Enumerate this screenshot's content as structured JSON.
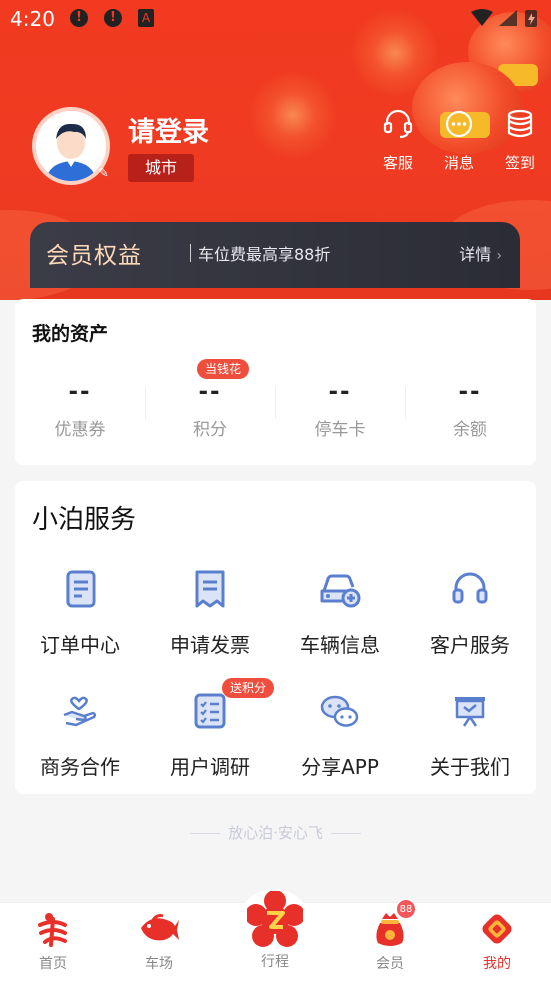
{
  "status_bar": {
    "time": "4:20"
  },
  "profile": {
    "login_title": "请登录",
    "city_label": "城市"
  },
  "top_actions": [
    {
      "label": "客服",
      "icon": "headset-icon"
    },
    {
      "label": "消息",
      "icon": "message-bubble-icon"
    },
    {
      "label": "签到",
      "icon": "coin-stack-icon"
    }
  ],
  "member_banner": {
    "title": "会员权益",
    "desc": "车位费最高享88折",
    "detail": "详情"
  },
  "assets": {
    "title": "我的资产",
    "badge": "当钱花",
    "items": [
      {
        "value": "--",
        "label": "优惠券"
      },
      {
        "value": "--",
        "label": "积分"
      },
      {
        "value": "--",
        "label": "停车卡"
      },
      {
        "value": "--",
        "label": "余额"
      }
    ]
  },
  "services": {
    "title": "小泊服务",
    "badge": "送积分",
    "items": [
      {
        "label": "订单中心",
        "icon": "order-doc-icon"
      },
      {
        "label": "申请发票",
        "icon": "invoice-icon"
      },
      {
        "label": "车辆信息",
        "icon": "car-add-icon"
      },
      {
        "label": "客户服务",
        "icon": "headset-icon"
      },
      {
        "label": "商务合作",
        "icon": "handshake-heart-icon"
      },
      {
        "label": "用户调研",
        "icon": "checklist-icon"
      },
      {
        "label": "分享APP",
        "icon": "wechat-icon"
      },
      {
        "label": "关于我们",
        "icon": "presentation-board-icon"
      }
    ]
  },
  "slogan": "放心泊·安心飞",
  "tabbar": {
    "items": [
      {
        "label": "首页",
        "icon": "home-logo-icon"
      },
      {
        "label": "车场",
        "icon": "fish-icon"
      },
      {
        "label": "行程",
        "icon": "trip-plum-icon"
      },
      {
        "label": "会员",
        "icon": "lucky-bag-icon"
      },
      {
        "label": "我的",
        "icon": "red-diamond-icon"
      }
    ],
    "member_badge": "88",
    "active_index": 4
  },
  "colors": {
    "brand_red": "#f13a20",
    "badge_red": "#f04e3c",
    "icon_blue": "#5b7fcf"
  }
}
